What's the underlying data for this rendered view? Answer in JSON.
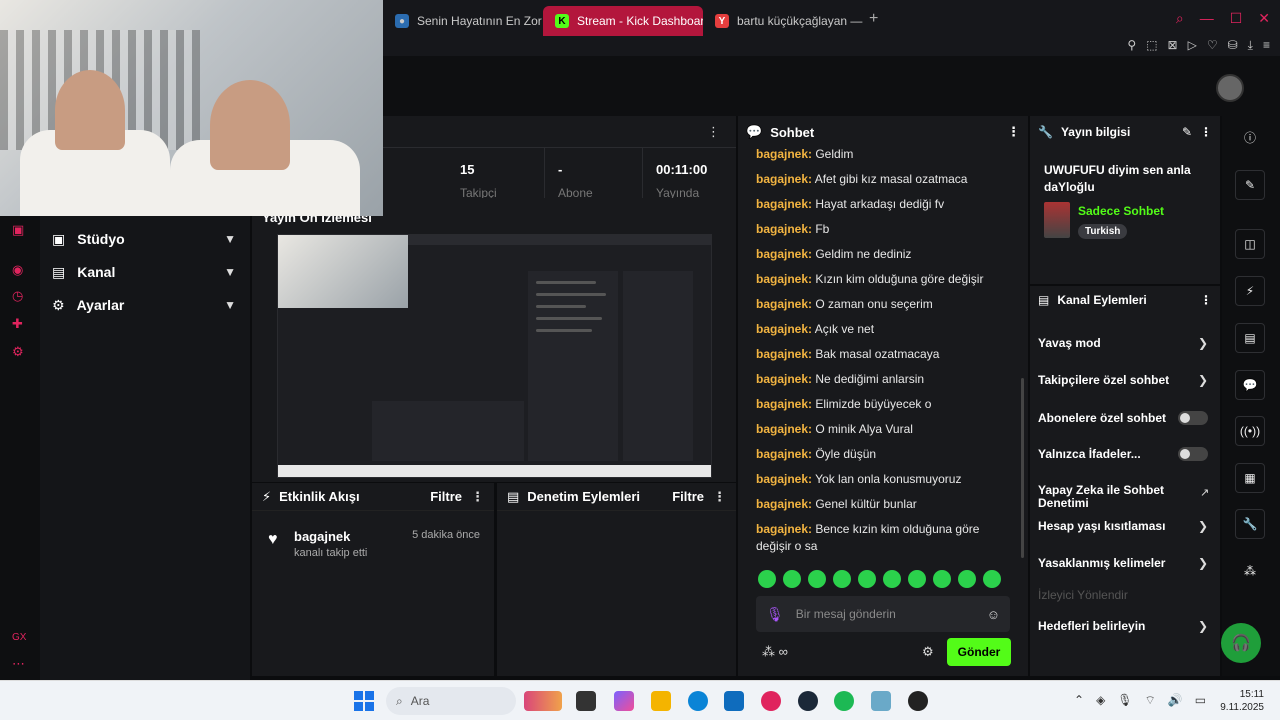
{
  "browser": {
    "tabs": [
      {
        "title": "Senin Hayatının En Zor Se"
      },
      {
        "title": "Stream - Kick Dashboard"
      },
      {
        "title": "bartu küçükçağlayan — Y"
      }
    ],
    "new_tab": "+"
  },
  "sidebar": {
    "items": [
      {
        "label": "Stüdyo"
      },
      {
        "label": "Kanal"
      },
      {
        "label": "Ayarlar"
      }
    ]
  },
  "stats": {
    "items": [
      {
        "value": "15",
        "label": "Takipçi"
      },
      {
        "value": "-",
        "label": "Abone"
      },
      {
        "value": "00:11:00",
        "label": "Yayında"
      }
    ]
  },
  "preview": {
    "title": "Yayın Ön İzlemesi"
  },
  "activity": {
    "title": "Etkinlik Akışı",
    "filter": "Filtre",
    "event": {
      "user": "bagajnek",
      "desc": "kanalı takip etti",
      "time": "5 dakika önce"
    }
  },
  "moderation": {
    "title": "Denetim Eylemleri",
    "filter": "Filtre"
  },
  "chat": {
    "title": "Sohbet",
    "messages": [
      {
        "user": "bagajnek:",
        "text": " Geldim"
      },
      {
        "user": "bagajnek:",
        "text": " Afet gibi kız masal ozatmaca"
      },
      {
        "user": "bagajnek:",
        "text": " Hayat arkadaşı dediği fv"
      },
      {
        "user": "bagajnek:",
        "text": " Fb"
      },
      {
        "user": "bagajnek:",
        "text": " Geldim ne dediniz"
      },
      {
        "user": "bagajnek:",
        "text": " Kızın kim olduğuna göre değişir"
      },
      {
        "user": "bagajnek:",
        "text": " O zaman onu seçerim"
      },
      {
        "user": "bagajnek:",
        "text": " Açık ve net"
      },
      {
        "user": "bagajnek:",
        "text": " Bak masal ozatmacaya"
      },
      {
        "user": "bagajnek:",
        "text": " Ne dediğimi anlarsin"
      },
      {
        "user": "bagajnek:",
        "text": " Elimizde büyüyecek o"
      },
      {
        "user": "bagajnek:",
        "text": " O minik Alya Vural"
      },
      {
        "user": "bagajnek:",
        "text": " Öyle düşün"
      },
      {
        "user": "bagajnek:",
        "text": " Yok lan onla konusmuyoruz"
      },
      {
        "user": "bagajnek:",
        "text": " Genel kültür bunlar"
      },
      {
        "user": "bagajnek:",
        "text": " Bence kızin kim olduğuna göre değişir o sa"
      }
    ],
    "input_placeholder": "Bir mesaj gönderin",
    "send_label": "Gönder"
  },
  "stream_info": {
    "title": "Yayın bilgisi",
    "stream_title": "UWUFUFU diyim sen anla daYloğlu",
    "category": "Sadece Sohbet",
    "tag": "Turkish"
  },
  "channel_actions": {
    "title": "Kanal Eylemleri",
    "items": [
      {
        "label": "Yavaş mod"
      },
      {
        "label": "Takipçilere özel sohbet"
      },
      {
        "label": "Abonelere özel sohbet"
      },
      {
        "label": "Yalnızca İfadeler..."
      },
      {
        "label": "Yapay Zeka ile Sohbet Denetimi"
      },
      {
        "label": "Hesap yaşı kısıtlaması"
      },
      {
        "label": "Yasaklanmış kelimeler"
      },
      {
        "label": "İzleyici Yönlendir"
      },
      {
        "label": "Hedefleri belirleyin"
      }
    ]
  },
  "taskbar": {
    "search": "Ara",
    "time": "15:11",
    "date": "9.11.2025"
  },
  "colors": {
    "accent": "#53fc18",
    "username": "#f2b441",
    "active_tab": "#b3163c"
  }
}
